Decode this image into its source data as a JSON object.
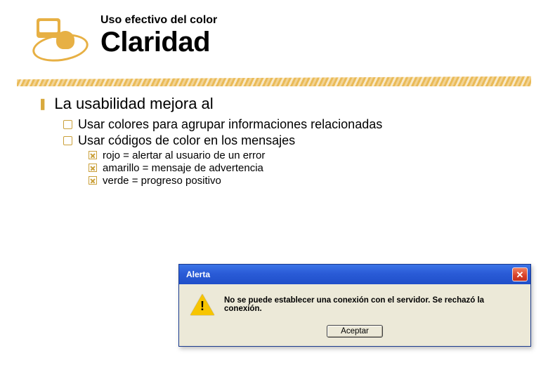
{
  "header": {
    "subtitle": "Uso efectivo del color",
    "title": "Claridad"
  },
  "bullets": {
    "l1": "La usabilidad mejora al",
    "l2a": "Usar colores para agrupar informaciones relacionadas",
    "l2b": "Usar códigos de color en los mensajes",
    "l3a": "rojo = alertar al usuario de un error",
    "l3b": "amarillo = mensaje de advertencia",
    "l3c": "verde = progreso positivo"
  },
  "dialog": {
    "title": "Alerta",
    "message": "No se puede establecer una conexión con el servidor. Se rechazó la conexión.",
    "button": "Aceptar"
  }
}
